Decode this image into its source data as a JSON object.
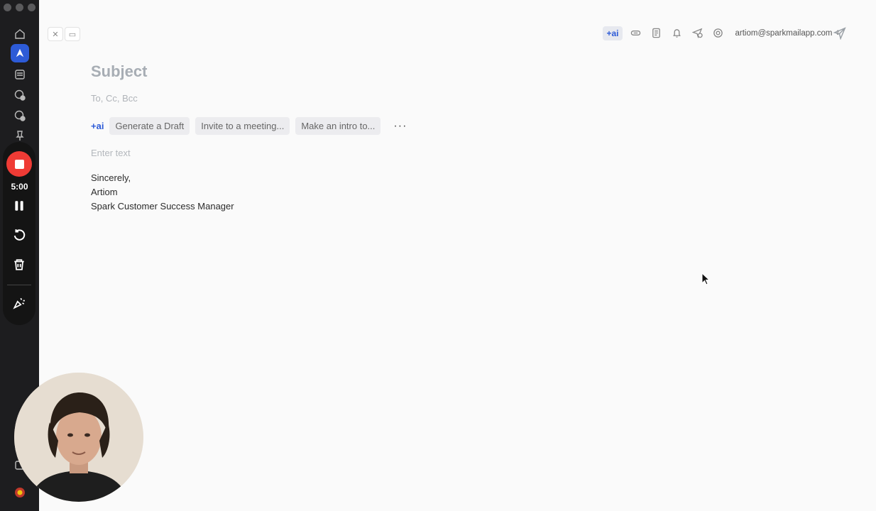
{
  "sidebar": {
    "icons": [
      "home-icon",
      "spark-logo-icon",
      "inbox-icon",
      "clock-badge-icon",
      "settings-badge-icon",
      "pin-icon",
      "calendar-icon",
      "app-badge-icon"
    ]
  },
  "recorder": {
    "time": "5:00",
    "icons": [
      "stop-icon",
      "pause-icon",
      "restart-icon",
      "trash-icon",
      "effects-icon"
    ],
    "accent": "#ef3b35"
  },
  "toolbar": {
    "ai_label": "+ai",
    "icons": [
      "attachment-icon",
      "template-icon",
      "bell-icon",
      "send-later-icon",
      "mention-icon"
    ],
    "account": "artiom@sparkmailapp.com",
    "send_icon": "send-icon"
  },
  "compose": {
    "subject_placeholder": "Subject",
    "recipients_placeholder": "To, Cc, Bcc",
    "ai_label": "+ai",
    "ai_actions": [
      "Generate a Draft",
      "Invite to a meeting...",
      "Make an intro to..."
    ],
    "more": "···",
    "body_placeholder": "Enter text",
    "signature": [
      "Sincerely,",
      "Artiom",
      "Spark Customer Success Manager"
    ]
  },
  "colors": {
    "accent": "#2d5bd7",
    "rail": "#1d1d1f"
  }
}
